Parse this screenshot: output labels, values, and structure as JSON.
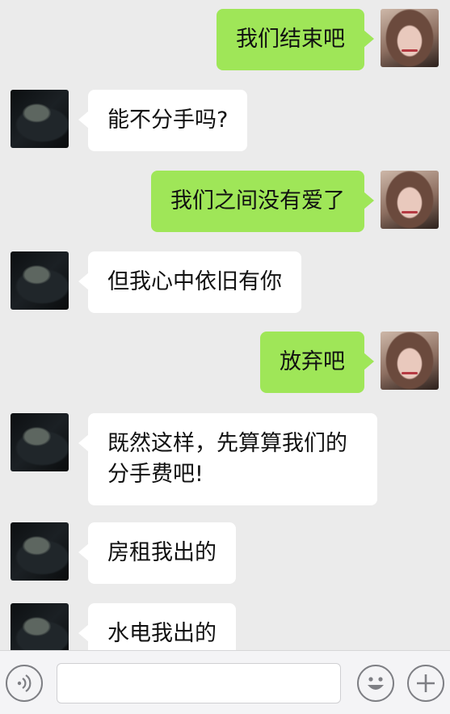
{
  "messages": [
    {
      "sender": "me",
      "text": "我们结束吧"
    },
    {
      "sender": "other",
      "text": "能不分手吗?"
    },
    {
      "sender": "me",
      "text": "我们之间没有爱了"
    },
    {
      "sender": "other",
      "text": "但我心中依旧有你"
    },
    {
      "sender": "me",
      "text": "放弃吧"
    },
    {
      "sender": "other",
      "text": "既然这样，先算算我们的分手费吧!"
    },
    {
      "sender": "other",
      "text": "房租我出的"
    },
    {
      "sender": "other",
      "text": "水电我出的"
    }
  ],
  "input": {
    "value": "",
    "placeholder": ""
  },
  "icons": {
    "voice": "voice-icon",
    "emoji": "emoji-icon",
    "plus": "plus-icon"
  },
  "colors": {
    "background": "#ebebeb",
    "me_bubble": "#9fe658",
    "other_bubble": "#ffffff"
  }
}
